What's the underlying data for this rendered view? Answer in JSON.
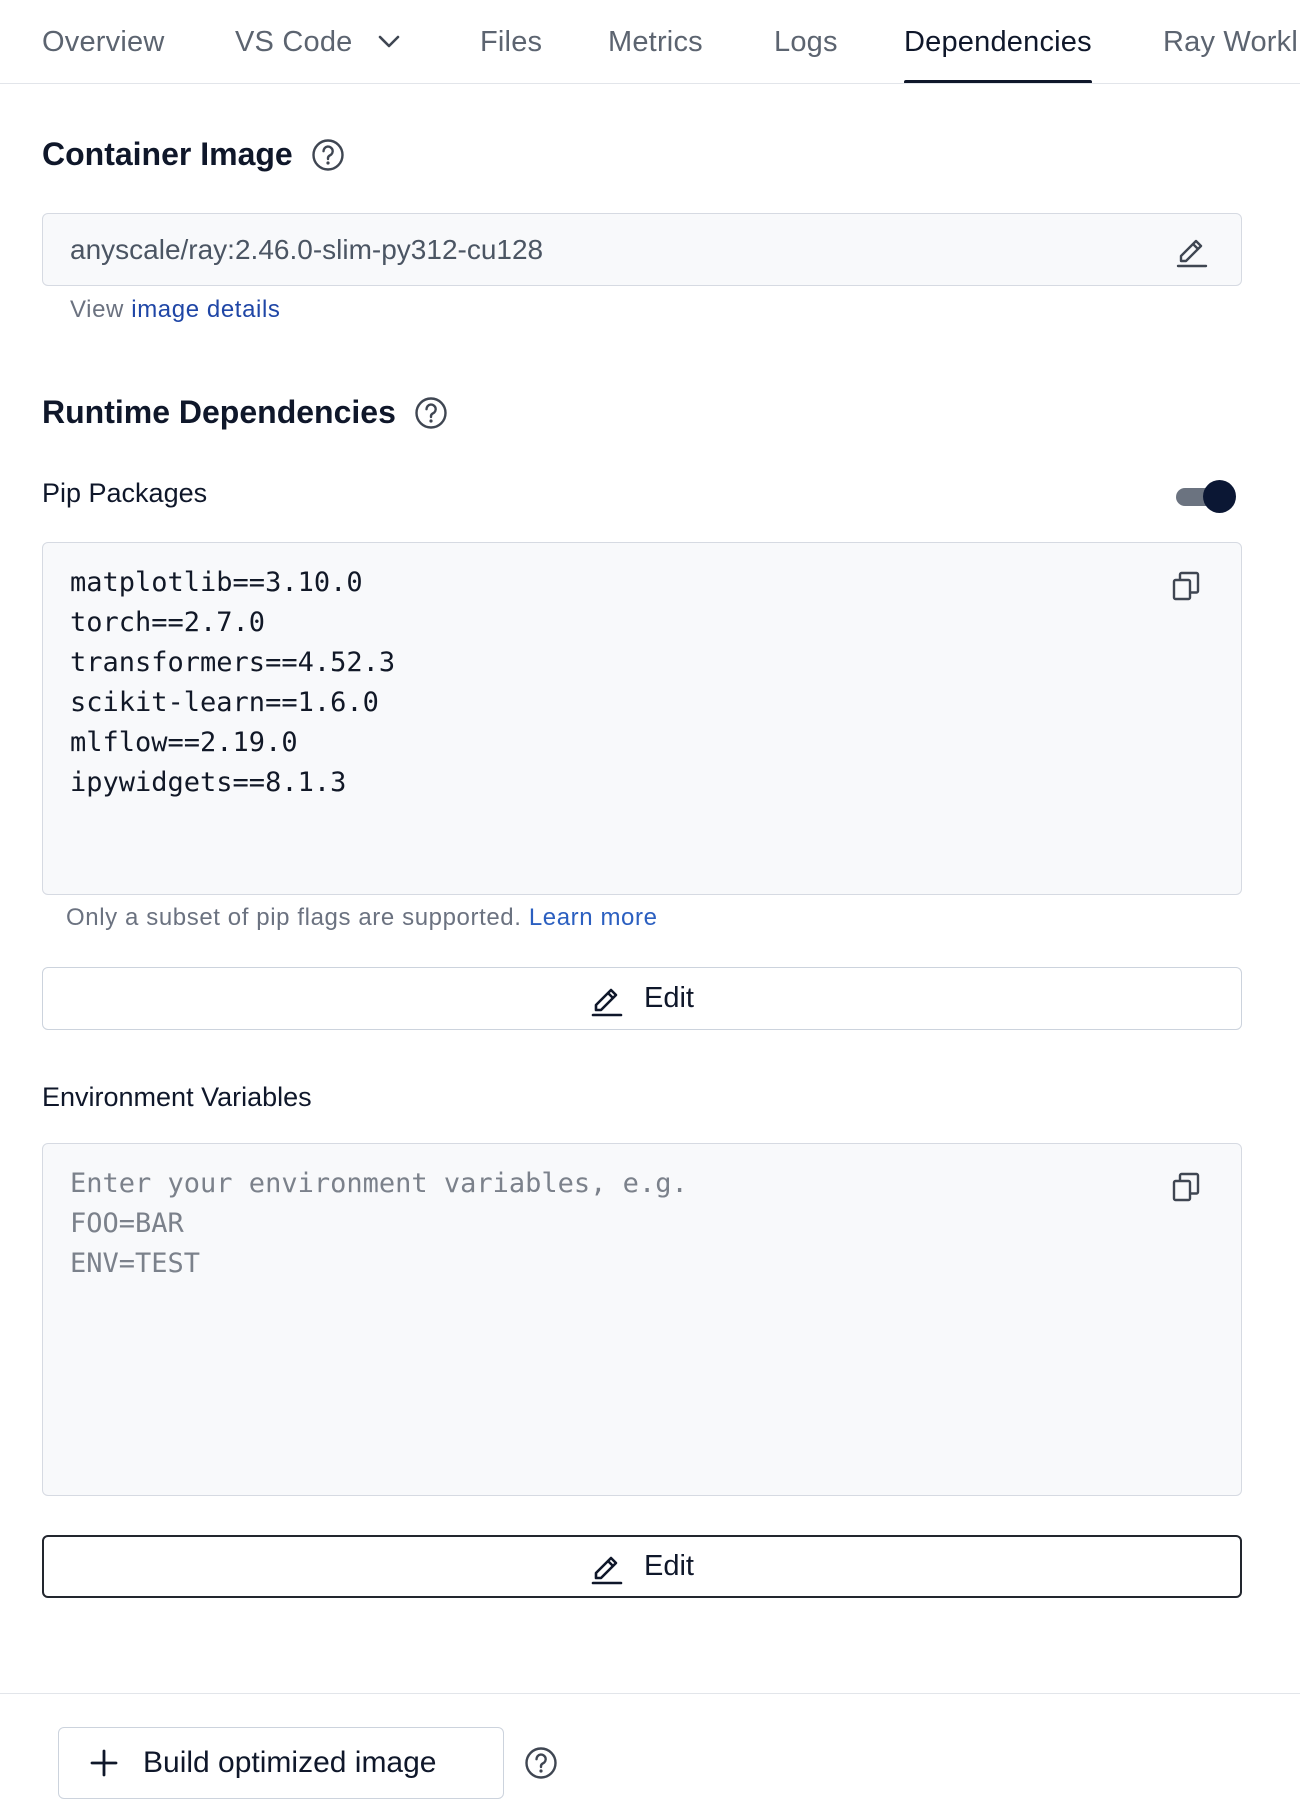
{
  "tabs": [
    {
      "label": "Overview",
      "active": false
    },
    {
      "label": "VS Code",
      "active": false,
      "has_dropdown": true
    },
    {
      "label": "Files",
      "active": false
    },
    {
      "label": "Metrics",
      "active": false
    },
    {
      "label": "Logs",
      "active": false
    },
    {
      "label": "Dependencies",
      "active": true
    },
    {
      "label": "Ray Workl",
      "active": false
    }
  ],
  "container_image": {
    "title": "Container Image",
    "value": "anyscale/ray:2.46.0-slim-py312-cu128",
    "view_prefix": "View",
    "view_link": "image details"
  },
  "runtime": {
    "title": "Runtime Dependencies",
    "pip": {
      "title": "Pip Packages",
      "enabled": true,
      "packages": [
        "matplotlib==3.10.0",
        "torch==2.7.0",
        "transformers==4.52.3",
        "scikit-learn==1.6.0",
        "mlflow==2.19.0",
        "ipywidgets==8.1.3"
      ],
      "hint": "Only a subset of pip flags are supported.",
      "hint_link": "Learn more",
      "edit_label": "Edit"
    },
    "env": {
      "title": "Environment Variables",
      "placeholder": [
        "Enter your environment variables, e.g.",
        "FOO=BAR",
        "ENV=TEST"
      ],
      "edit_label": "Edit"
    }
  },
  "footer": {
    "build_label": "Build optimized image"
  },
  "icons": {
    "help": "help-circle-icon",
    "edit": "pencil-icon",
    "copy": "copy-icon",
    "dropdown": "chevron-down-icon",
    "add": "plus-icon"
  },
  "colors": {
    "text": "#0f172a",
    "muted": "#5c6470",
    "link": "#1f46a6",
    "toggle_knob": "#0b1734",
    "border": "#d6dae2",
    "box_bg": "#f8f9fb"
  }
}
